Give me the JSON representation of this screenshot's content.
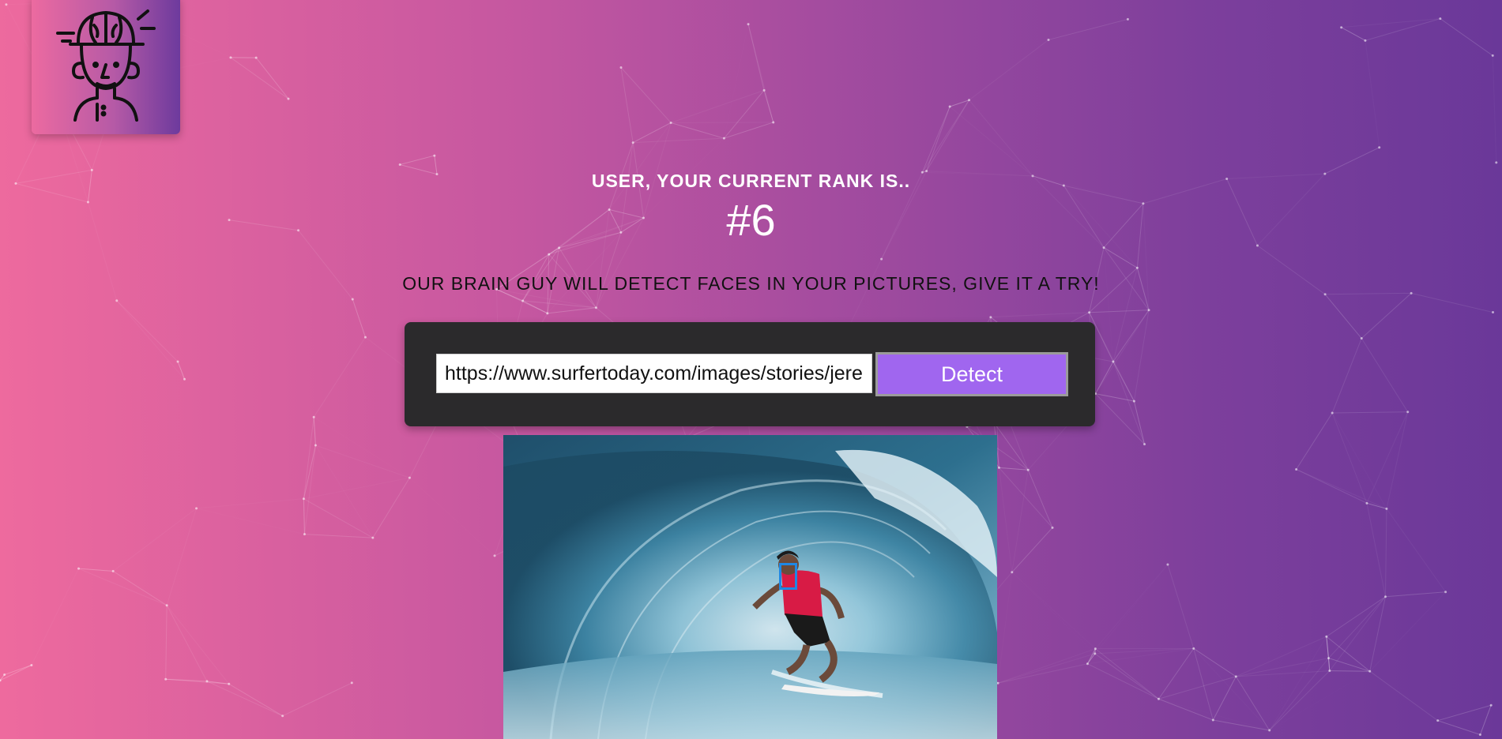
{
  "logo": {
    "icon": "brain-guy-icon"
  },
  "rank": {
    "label": "USER, YOUR CURRENT RANK IS..",
    "value": "#6"
  },
  "tagline": "OUR BRAIN GUY WILL DETECT FACES IN YOUR PICTURES, GIVE IT A TRY!",
  "form": {
    "url_value": "https://www.surfertoday.com/images/stories/jeremyflores.jpg",
    "detect_label": "Detect"
  },
  "colors": {
    "gradient_start": "#ee6a9e",
    "gradient_end": "#6a3899",
    "panel": "#2b2a2c",
    "button": "#a066ef",
    "face_box": "#1e88e5"
  }
}
